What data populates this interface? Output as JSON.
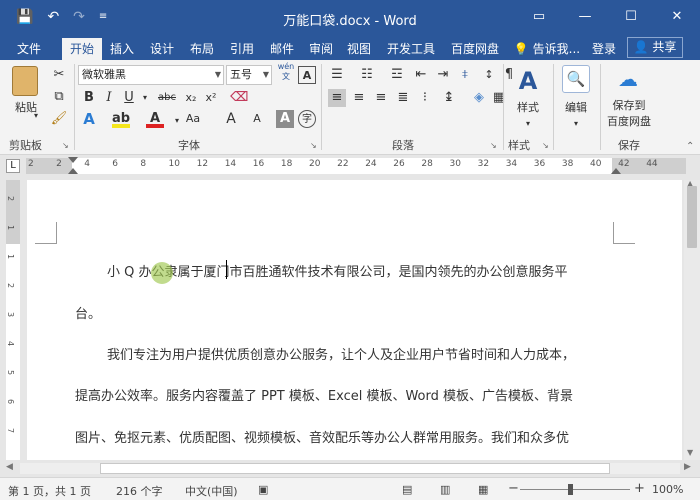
{
  "window": {
    "title": "万能口袋.docx - Word",
    "quick_access": {
      "save_icon": "💾",
      "undo_icon": "↶",
      "redo_icon": "↷",
      "customize_icon": "≡"
    },
    "controls": {
      "ribbon_display_icon": "▭",
      "minimize_icon": "—",
      "maximize_icon": "☐",
      "close_icon": "✕"
    }
  },
  "tabs": [
    "文件",
    "开始",
    "插入",
    "设计",
    "布局",
    "引用",
    "邮件",
    "审阅",
    "视图",
    "开发工具",
    "百度网盘"
  ],
  "active_tab": "开始",
  "tell_me": "告诉我...",
  "sign_in": "登录",
  "share": "共享",
  "ribbon": {
    "clipboard": {
      "label": "剪贴板",
      "paste": "粘贴"
    },
    "font": {
      "label": "字体",
      "font_name": "微软雅黑",
      "font_size": "五号",
      "phonetic": "wén",
      "bold": "B",
      "italic": "I",
      "underline": "U",
      "strike": "abc",
      "subscript": "x₂",
      "superscript": "x²",
      "text_effect": "A",
      "font_color": "A",
      "grow": "A",
      "shrink": "A",
      "change_case": "Aa",
      "shading": "A",
      "enclose": "字"
    },
    "paragraph": {
      "label": "段落"
    },
    "styles": {
      "label": "样式",
      "button": "样式"
    },
    "editing": {
      "button": "编辑"
    },
    "save": {
      "label": "保存",
      "button_line1": "保存到",
      "button_line2": "百度网盘"
    }
  },
  "ruler": {
    "numbers": [
      "2",
      "2",
      "4",
      "6",
      "8",
      "10",
      "12",
      "14",
      "16",
      "18",
      "20",
      "22",
      "24",
      "26",
      "28",
      "30",
      "32",
      "34",
      "36",
      "38",
      "40",
      "42",
      "44"
    ],
    "vertical_numbers": [
      "2",
      "1",
      "1",
      "2",
      "3",
      "4",
      "5",
      "6",
      "7"
    ]
  },
  "document": {
    "lines": [
      "小 Q 办公隶属于厦门市百胜通软件技术有限公司，是国内领先的办公创意服务平",
      "台。",
      "我们专注为用户提供优质创意办公服务，让个人及企业用户节省时间和人力成本，",
      "提高办公效率。服务内容覆盖了 PPT 模板、Excel 模板、Word 模板、广告模板、背景",
      "图片、免抠元素、优质配图、视频模板、音效配乐等办公人群常用服务。我们和众多优"
    ]
  },
  "status": {
    "page": "第 1 页，共 1 页",
    "words": "216 个字",
    "language": "中文(中国)",
    "zoom": "100%",
    "zoom_minus": "−",
    "zoom_plus": "+"
  }
}
